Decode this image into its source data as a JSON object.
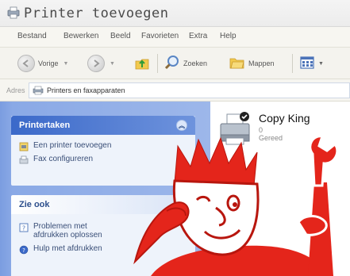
{
  "window": {
    "title": "Printer toevoegen"
  },
  "menubar": {
    "items": [
      "Bestand",
      "Bewerken",
      "Beeld",
      "Favorieten",
      "Extra",
      "Help"
    ]
  },
  "toolbar": {
    "back_label": "Vorige",
    "search_label": "Zoeken",
    "folders_label": "Mappen"
  },
  "address": {
    "label": "Adres",
    "value": "Printers en faxapparaten"
  },
  "tasks_panel": {
    "title": "Printertaken",
    "items": [
      "Een printer toevoegen",
      "Fax configureren"
    ]
  },
  "see_also_panel": {
    "title": "Zie ook",
    "items": [
      "Problemen met afdrukken oplossen",
      "Hulp met afdrukken"
    ]
  },
  "printer": {
    "name": "Copy King",
    "count": "0",
    "status": "Gereed"
  },
  "colors": {
    "mascot_red": "#e4251b",
    "panel_blue": "#3b69c9"
  }
}
